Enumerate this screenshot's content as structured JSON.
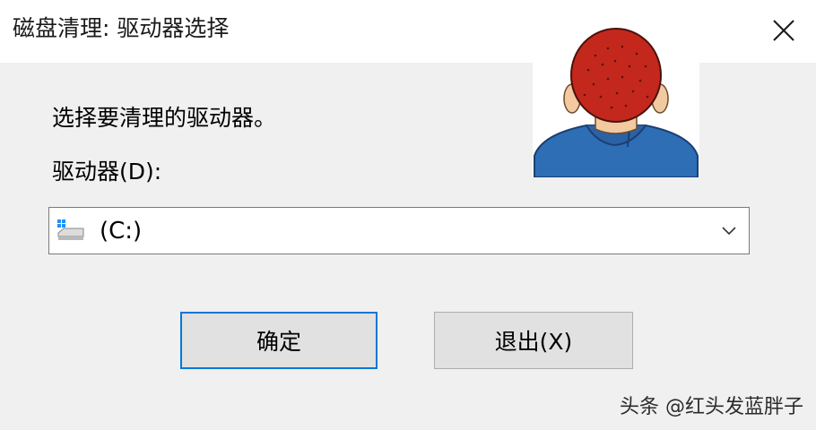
{
  "window": {
    "title": "磁盘清理: 驱动器选择",
    "close_icon": "close-icon"
  },
  "main": {
    "prompt": "选择要清理的驱动器。",
    "drive_label": "驱动器(D):",
    "drive_select": {
      "selected_value": "(C:)",
      "icon": "windows-drive-icon",
      "dropdown_icon": "chevron-down-icon"
    }
  },
  "buttons": {
    "ok_label": "确定",
    "exit_label": "退出(X)"
  },
  "watermark": "头条 @红头发蓝胖子",
  "colors": {
    "title_bar": "#ffffff",
    "dialog_bg": "#f0f0f0",
    "default_button_border": "#0078d7",
    "avatar_hair": "#c4281c",
    "avatar_shirt": "#2e6eb5"
  }
}
